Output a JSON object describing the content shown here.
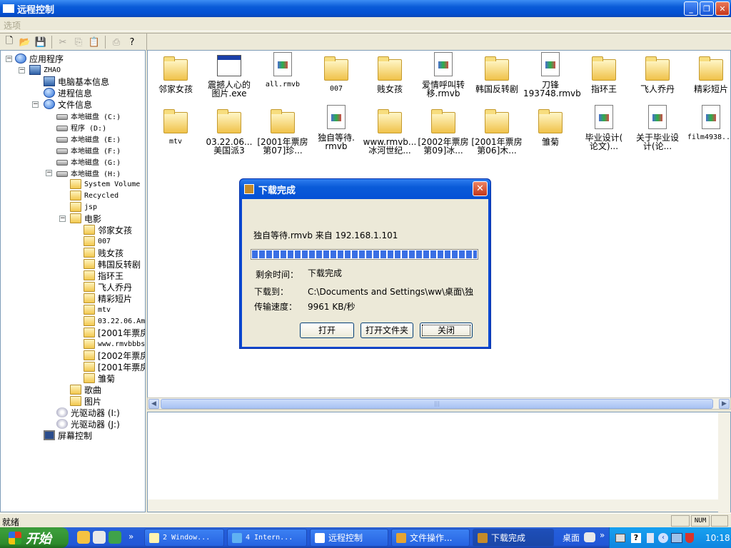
{
  "window": {
    "title": "远程控制",
    "minimize": "_",
    "restore": "❐",
    "close": "✕"
  },
  "menu": {
    "options_label": "选项"
  },
  "toolbar": {
    "icons": [
      "new-icon",
      "open-icon",
      "save-icon",
      "cut-icon",
      "copy-icon",
      "paste-icon",
      "print-icon",
      "help-icon"
    ]
  },
  "tree": {
    "root": "应用程序",
    "host": "ZHAO",
    "pc_info": "电脑基本信息",
    "process_info": "进程信息",
    "file_info": "文件信息",
    "drive_c": "本地磁盘 (C:)",
    "drive_d": "程序 (D:)",
    "drive_e": "本地磁盘 (E:)",
    "drive_f": "本地磁盘 (F:)",
    "drive_g": "本地磁盘 (G:)",
    "drive_h": "本地磁盘 (H:)",
    "h_system_volume": "System Volume",
    "h_recycled": "Recycled",
    "h_jsp": "jsp",
    "h_movies": "电影",
    "movies": [
      "邻家女孩",
      "007",
      "贱女孩",
      "韩国反转剧",
      "指环王",
      "飞人乔丹",
      "精彩短片",
      "mtv",
      "03.22.06.Am",
      "[2001年票房",
      "www.rmvbbbs",
      "[2002年票房",
      "[2001年票房",
      "雏菊"
    ],
    "h_songs": "歌曲",
    "h_pictures": "图片",
    "cd_i": "光驱动器 (I:)",
    "cd_j": "光驱动器 (J:)",
    "screen_control": "屏幕控制"
  },
  "files": {
    "row1": [
      {
        "name": "邻家女孩",
        "type": "folder"
      },
      {
        "name": "震撼人心的\n图片.exe",
        "type": "exe"
      },
      {
        "name": "all.rmvb",
        "type": "doc"
      },
      {
        "name": "007",
        "type": "folder"
      },
      {
        "name": "贱女孩",
        "type": "folder"
      },
      {
        "name": "爱情呼叫转\n移.rmvb",
        "type": "doc"
      },
      {
        "name": "韩国反转剧",
        "type": "folder"
      },
      {
        "name": "刀锋\n193748.rmvb",
        "type": "doc"
      },
      {
        "name": "指环王",
        "type": "folder"
      },
      {
        "name": "飞人乔丹",
        "type": "folder"
      },
      {
        "name": "精彩短片",
        "type": "folder"
      }
    ],
    "row2": [
      {
        "name": "mtv",
        "type": "folder"
      },
      {
        "name": "03.22.06...\n美国派3",
        "type": "folder"
      },
      {
        "name": "[2001年票房\n第07]珍...",
        "type": "folder"
      },
      {
        "name": "独自等待.\nrmvb",
        "type": "doc"
      },
      {
        "name": "www.rmvb...\n冰河世纪...",
        "type": "folder"
      },
      {
        "name": "[2002年票房\n第09]冰...",
        "type": "folder"
      },
      {
        "name": "[2001年票房\n第06]木...",
        "type": "folder"
      },
      {
        "name": "雏菊",
        "type": "folder"
      },
      {
        "name": "毕业设计(\n论文)...",
        "type": "doc"
      },
      {
        "name": "关于毕业设\n计(论...",
        "type": "doc"
      },
      {
        "name": "film4938...",
        "type": "doc"
      }
    ]
  },
  "dialog": {
    "title": "下载完成",
    "file_line": "独自等待.rmvb 来自 192.168.1.101",
    "progress": 1.0,
    "remaining_label": "剩余时间：",
    "remaining_value": "下载完成",
    "saved_to_label": "下载到：",
    "saved_to_value": "C:\\Documents and Settings\\ww\\桌面\\独",
    "speed_label": "传输速度：",
    "speed_value": "9961 KB/秒",
    "open_button": "打开",
    "open_folder_button": "打开文件夹",
    "close_button": "关闭",
    "close_x": "✕"
  },
  "statusbar": {
    "text": "就绪",
    "num": "NUM"
  },
  "taskbar": {
    "start_label": "开始",
    "tasks": [
      "2 Window...",
      "4 Intern...",
      "远程控制",
      "文件操作...",
      "下载完成"
    ],
    "desktop_label": "桌面",
    "chevron": "»",
    "clock": "10:18"
  },
  "colors": {
    "accent": "#0a5bd8",
    "tray": "#0f85e0",
    "start": "#3a9c3a"
  }
}
